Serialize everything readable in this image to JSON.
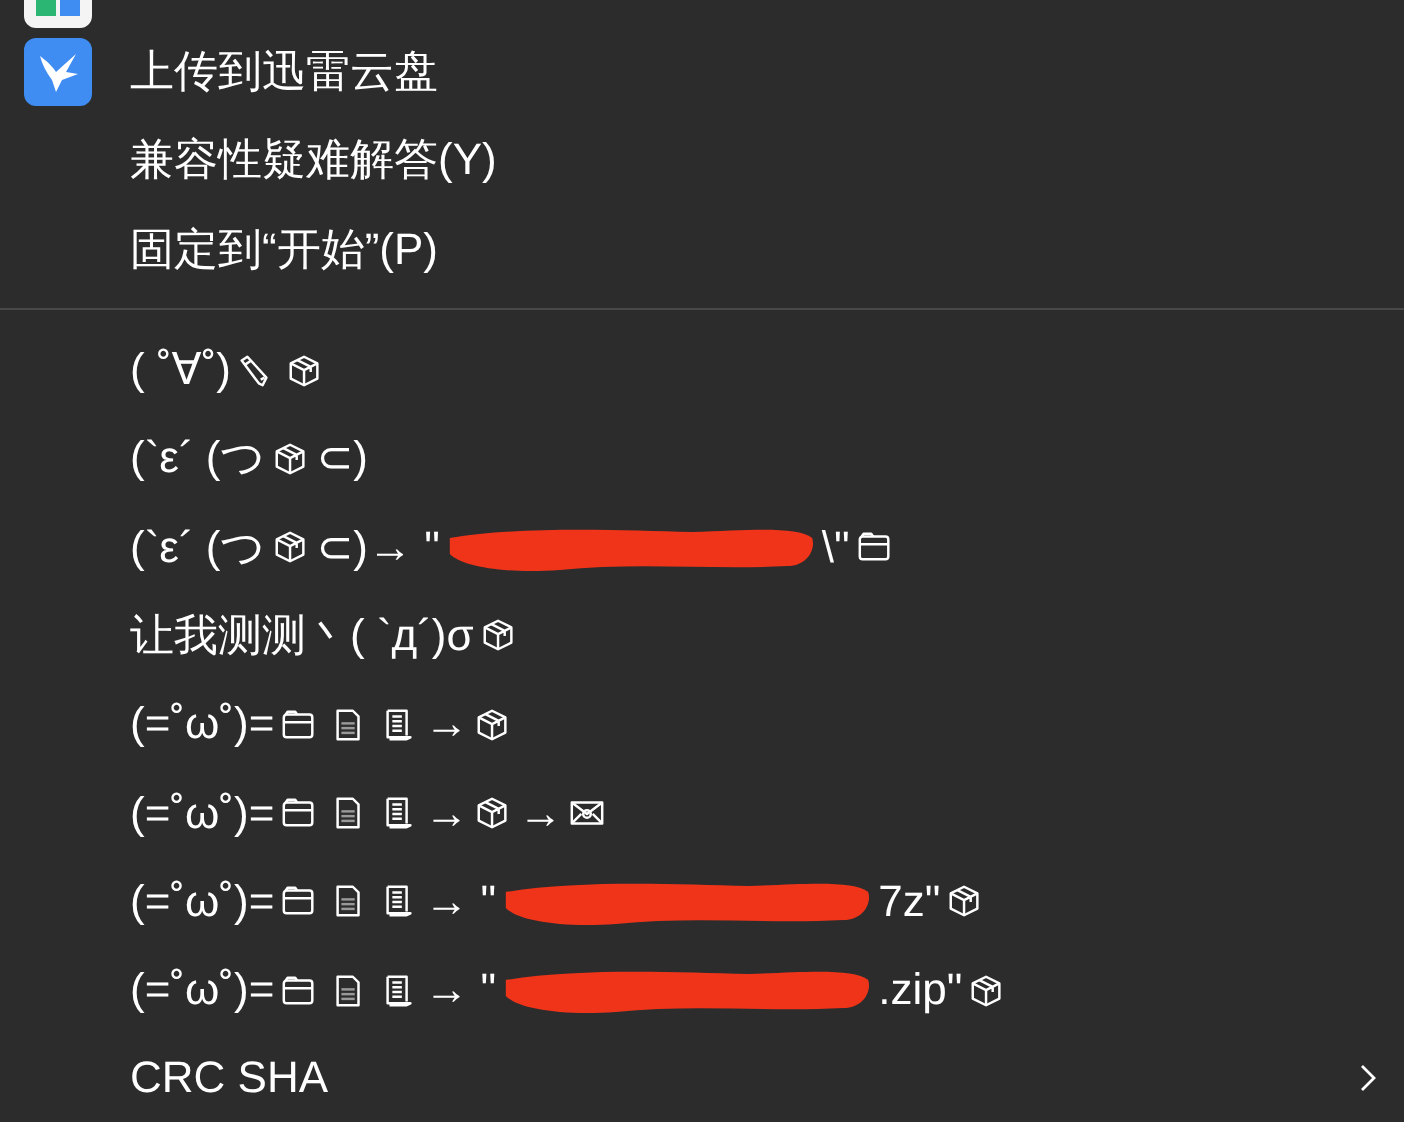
{
  "menu": {
    "groups": [
      {
        "items": [
          {
            "kind": "cut-off"
          },
          {
            "kind": "app-item",
            "segments": [
              {
                "kind": "text",
                "text": "上传到迅雷云盘"
              }
            ]
          },
          {
            "kind": "item",
            "segments": [
              {
                "kind": "text",
                "text": "兼容性疑难解答(Y)"
              }
            ]
          },
          {
            "kind": "item",
            "segments": [
              {
                "kind": "text",
                "text": "固定到“开始”(P)"
              }
            ]
          }
        ]
      },
      {
        "items": [
          {
            "kind": "item",
            "segments": [
              {
                "kind": "text",
                "text": "( ˚∀˚)"
              },
              {
                "kind": "pencil"
              },
              {
                "kind": "box"
              }
            ]
          },
          {
            "kind": "item",
            "segments": [
              {
                "kind": "text",
                "text": "(`ε´ (つ"
              },
              {
                "kind": "box"
              },
              {
                "kind": "text",
                "text": "⊂)"
              }
            ]
          },
          {
            "kind": "item",
            "segments": [
              {
                "kind": "text",
                "text": "(`ε´ (つ"
              },
              {
                "kind": "box"
              },
              {
                "kind": "text",
                "text": "⊂)→ \""
              },
              {
                "kind": "redaction"
              },
              {
                "kind": "text",
                "text": "\\\""
              },
              {
                "kind": "folder"
              }
            ]
          },
          {
            "kind": "item",
            "segments": [
              {
                "kind": "text",
                "text": "让我测测丶( `д´)σ"
              },
              {
                "kind": "box"
              }
            ]
          },
          {
            "kind": "item",
            "segments": [
              {
                "kind": "text",
                "text": "(=˚ω˚)="
              },
              {
                "kind": "folder"
              },
              {
                "kind": "document"
              },
              {
                "kind": "scroll"
              },
              {
                "kind": "text",
                "text": "→"
              },
              {
                "kind": "box"
              }
            ]
          },
          {
            "kind": "item",
            "segments": [
              {
                "kind": "text",
                "text": "(=˚ω˚)="
              },
              {
                "kind": "folder"
              },
              {
                "kind": "document"
              },
              {
                "kind": "scroll"
              },
              {
                "kind": "text",
                "text": "→"
              },
              {
                "kind": "box"
              },
              {
                "kind": "text",
                "text": "→"
              },
              {
                "kind": "mail"
              }
            ]
          },
          {
            "kind": "item",
            "segments": [
              {
                "kind": "text",
                "text": "(=˚ω˚)="
              },
              {
                "kind": "folder"
              },
              {
                "kind": "document"
              },
              {
                "kind": "scroll"
              },
              {
                "kind": "text",
                "text": "→ \""
              },
              {
                "kind": "redaction"
              },
              {
                "kind": "text",
                "text": "7z\""
              },
              {
                "kind": "box"
              }
            ]
          },
          {
            "kind": "item",
            "segments": [
              {
                "kind": "text",
                "text": "(=˚ω˚)="
              },
              {
                "kind": "folder"
              },
              {
                "kind": "document"
              },
              {
                "kind": "scroll"
              },
              {
                "kind": "text",
                "text": "→ \""
              },
              {
                "kind": "redaction"
              },
              {
                "kind": "text",
                "text": ".zip\""
              },
              {
                "kind": "box"
              }
            ]
          },
          {
            "kind": "item",
            "submenu": true,
            "segments": [
              {
                "kind": "text",
                "text": "CRC SHA"
              }
            ]
          }
        ]
      }
    ]
  }
}
